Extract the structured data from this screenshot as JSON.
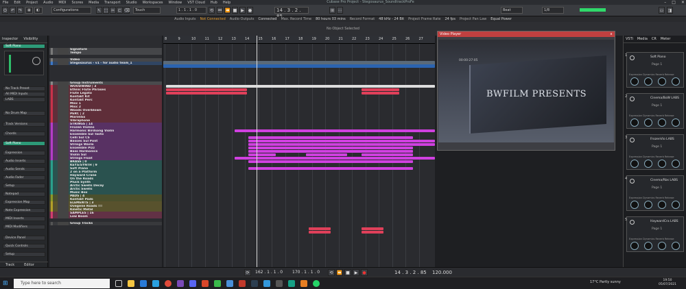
{
  "menubar": {
    "items": [
      "File",
      "Edit",
      "Project",
      "Audio",
      "MIDI",
      "Scores",
      "Media",
      "Transport",
      "Studio",
      "Workspaces",
      "Window",
      "VST Cloud",
      "Hub",
      "Help"
    ]
  },
  "window": {
    "title": "Cubase Pro Project - Stegosaurus_SoundtrackProFe"
  },
  "toolbar": {
    "configurations": "Configurations",
    "touch": "Touch",
    "time_display": "14 . 3 . 2 . 85",
    "quantize": "Beat",
    "quantize2": "1/8",
    "snap_left": "1 . 1 . 1 . 0",
    "snap_right": "1 . 1 . 1 . 0"
  },
  "status": {
    "audio_inputs_label": "Audio Inputs",
    "audio_inputs_value": "Not Connected",
    "audio_outputs_label": "Audio Outputs",
    "audio_outputs_value": "Connected",
    "max_record_label": "Max. Record Time",
    "max_record_value": "80 hours 03 mins",
    "record_format_label": "Record Format",
    "record_format_value": "48 kHz - 24 Bit",
    "frame_rate_label": "Project Frame Rate",
    "frame_rate_value": "24 fps",
    "pan_law_label": "Project Pan Law",
    "pan_law_value": "Equal Power"
  },
  "info_line": "No Object Selected",
  "left_zone": {
    "tabs": [
      "Inspector",
      "Visibility"
    ],
    "track_name": "Soft Piano",
    "items": [
      "Soft Piano",
      "No Track Preset",
      "All MIDI Inputs",
      "LABS",
      "No Drum Map",
      "Track Versions",
      "Chords",
      "Soft Piano",
      "Expression",
      "Audio Inserts",
      "Audio Sends",
      "Audio Fader",
      "Setup",
      "Notepad",
      "Expression Map",
      "Note Expression",
      "MIDI Inserts",
      "MIDI Modifiers",
      "Device Panel",
      "Quick Controls",
      "Setup"
    ],
    "footer": [
      "Track",
      "Editor"
    ]
  },
  "tracks": [
    {
      "name": "Signature",
      "color": "#7a7a7a"
    },
    {
      "name": "Tempo",
      "color": "#7a7a7a"
    },
    {
      "name": "Video",
      "color": "#7a7a7a"
    },
    {
      "name": "Stegosaurus - v1 - for audio team_1",
      "color": "#3c78c8"
    },
    {
      "name": "Group Instruments",
      "color": "#888888"
    },
    {
      "name": "WOODWIND | 3",
      "color": "#c8324a"
    },
    {
      "name": "Ethnic Flute Phrases",
      "color": "#c8324a"
    },
    {
      "name": "Flute Legato",
      "color": "#c8324a"
    },
    {
      "name": "Kontakt Kit",
      "color": "#c8324a"
    },
    {
      "name": "Kontakt Perc",
      "color": "#c8324a"
    },
    {
      "name": "Misc 1",
      "color": "#c8324a"
    },
    {
      "name": "Misc 2",
      "color": "#c8324a"
    },
    {
      "name": "Woods Overblown",
      "color": "#c8324a"
    },
    {
      "name": "PERC | 2",
      "color": "#c8324a"
    },
    {
      "name": "Marimba",
      "color": "#c8324a"
    },
    {
      "name": "Vibraphone",
      "color": "#c8324a"
    },
    {
      "name": "STRINGS | 14",
      "color": "#b43cc8"
    },
    {
      "name": "Frozen Violins",
      "color": "#b43cc8"
    },
    {
      "name": "Harmonic Birdsong Violin",
      "color": "#b43cc8"
    },
    {
      "name": "Ensemble Sul Tasto",
      "color": "#b43cc8"
    },
    {
      "name": "Celli Sul CS",
      "color": "#b43cc8"
    },
    {
      "name": "Basses Sul Pont",
      "color": "#b43cc8"
    },
    {
      "name": "Strings Warm",
      "color": "#b43cc8"
    },
    {
      "name": "Ensemble Pizz",
      "color": "#b43cc8"
    },
    {
      "name": "Bass Harmonics",
      "color": "#b43cc8"
    },
    {
      "name": "Violin Sul",
      "color": "#b43cc8"
    },
    {
      "name": "Strings Float",
      "color": "#b43cc8"
    },
    {
      "name": "BRASS | 0",
      "color": "#2aa08c"
    },
    {
      "name": "KEYS/SYNTH | 9",
      "color": "#2aa08c"
    },
    {
      "name": "Soft Piano",
      "color": "#2aa08c"
    },
    {
      "name": "2 on a Platform",
      "color": "#2aa08c"
    },
    {
      "name": "Hayward Crane",
      "color": "#2aa08c"
    },
    {
      "name": "On the Roads",
      "color": "#2aa08c"
    },
    {
      "name": "Pluck Synth",
      "color": "#2aa08c"
    },
    {
      "name": "Arctic Swells Decay",
      "color": "#2aa08c"
    },
    {
      "name": "Arctic Swells",
      "color": "#2aa08c"
    },
    {
      "name": "Music Box",
      "color": "#2aa08c"
    },
    {
      "name": "PADS | 4",
      "color": "#8c9a28"
    },
    {
      "name": "Kontakt Pads",
      "color": "#8c9a28"
    },
    {
      "name": "ELEMENTS | 3",
      "color": "#b4a028"
    },
    {
      "name": "Ovegene Roads !!!",
      "color": "#b4a028"
    },
    {
      "name": "Kinetic Metal",
      "color": "#b4a028"
    },
    {
      "name": "SAMPLES | 16",
      "color": "#d23c6e"
    },
    {
      "name": "Low Boom",
      "color": "#d23c6e"
    },
    {
      "name": "Group Tracks",
      "color": "#555555"
    }
  ],
  "ruler": {
    "bars": [
      "8",
      "9",
      "10",
      "11",
      "12",
      "13",
      "14",
      "15",
      "16",
      "17",
      "18",
      "19",
      "20",
      "21",
      "22",
      "23",
      "24",
      "25",
      "26",
      "27"
    ]
  },
  "video_player": {
    "title": "Video Player",
    "timecode": "00:00:27:05",
    "overlay_text": "BWFILM PRESENTS",
    "close": "x"
  },
  "right_zone": {
    "tabs": [
      "VSTi",
      "Media",
      "CR",
      "Meter"
    ],
    "slots": [
      {
        "num": "1",
        "name": "Soft Piano",
        "sub": "Page 1"
      },
      {
        "num": "2",
        "name": "Cinema/BoW LABS",
        "sub": "Page 1"
      },
      {
        "num": "3",
        "name": "FrozenVio LABS",
        "sub": "Page 1"
      },
      {
        "num": "4",
        "name": "Cinema/Rbs LABS",
        "sub": "Page 1"
      },
      {
        "num": "5",
        "name": "HaywardCra LABS",
        "sub": "Page 1"
      }
    ],
    "knob_labels": "Expression  Dynamics  Reverb  Release"
  },
  "transport": {
    "left_locator": "162 . 1 . 1 . 0",
    "right_locator": "170 . 1 . 1 . 0",
    "position": "14 . 3 . 2 . 85",
    "tempo": "120.000"
  },
  "taskbar": {
    "search_placeholder": "Type here to search",
    "weather": "17°C  Partly sunny",
    "time": "19:50",
    "date": "05/07/2021"
  }
}
